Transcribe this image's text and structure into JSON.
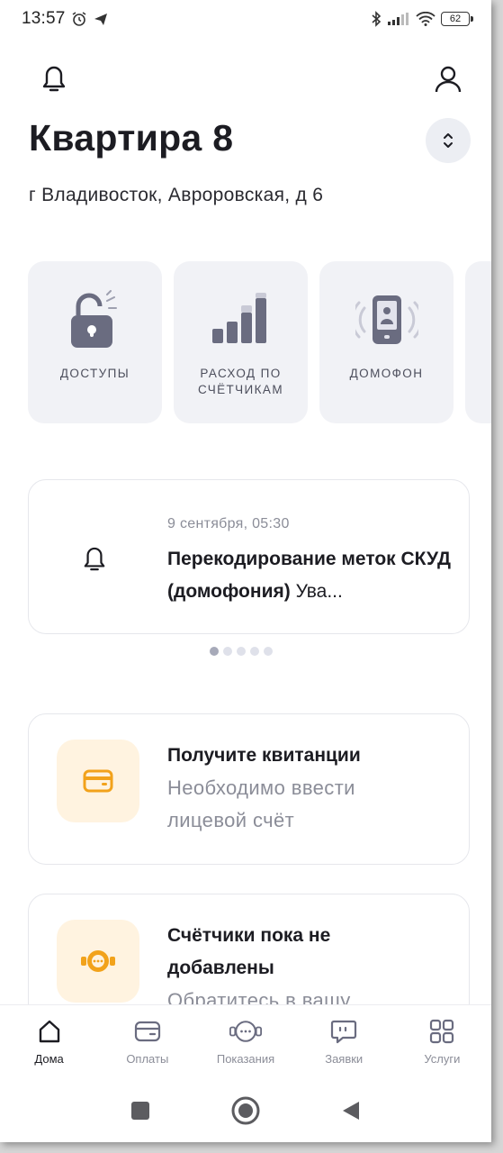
{
  "status_bar": {
    "time": "13:57",
    "battery": "62"
  },
  "header": {
    "title": "Квартира 8",
    "address": "г Владивосток, Авроровская, д 6"
  },
  "tiles": [
    {
      "label_line1": "ДОСТУПЫ",
      "label_line2": ""
    },
    {
      "label_line1": "РАСХОД ПО",
      "label_line2": "СЧЁТЧИКАМ"
    },
    {
      "label_line1": "ДОМОФОН",
      "label_line2": ""
    }
  ],
  "news": {
    "date": "9 сентября, 05:30",
    "title": "Перекодирование меток СКУД (домофония)",
    "preview": " Ува..."
  },
  "carousel": {
    "total": 5,
    "active": 1
  },
  "cards": [
    {
      "title": "Получите квитанции",
      "subtitle": "Необходимо ввести лицевой счёт"
    },
    {
      "title": "Счётчики пока не добавлены",
      "subtitle": "Обратитесь в вашу"
    }
  ],
  "bottom_nav": [
    {
      "label": "Дома",
      "active": true
    },
    {
      "label": "Оплаты",
      "active": false
    },
    {
      "label": "Показания",
      "active": false
    },
    {
      "label": "Заявки",
      "active": false
    },
    {
      "label": "Услуги",
      "active": false
    }
  ],
  "colors": {
    "accent_orange": "#f2a21b",
    "tile_bg": "#f1f2f6",
    "icon_grey": "#6a6c80",
    "muted_text": "#8b8d98"
  }
}
